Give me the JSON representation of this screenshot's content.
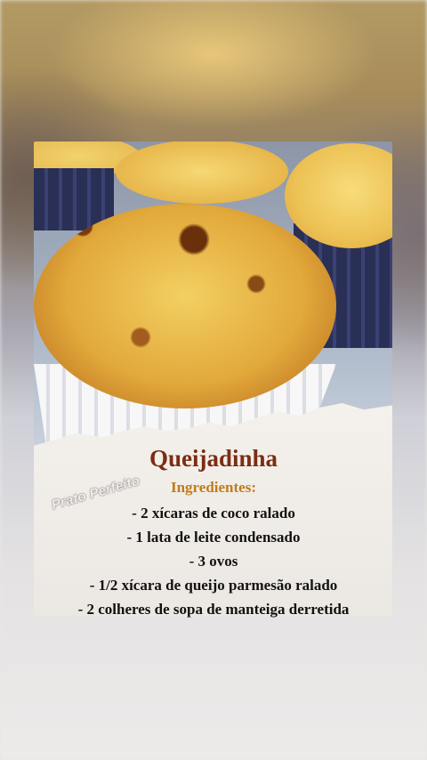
{
  "recipe": {
    "title": "Queijadinha",
    "ingredients_heading": "Ingredientes:",
    "ingredients": [
      "- 2 xícaras de coco ralado",
      "- 1 lata de leite condensado",
      "- 3 ovos",
      "- 1/2 xícara de queijo parmesão ralado",
      "- 2 colheres de sopa de manteiga derretida"
    ]
  },
  "watermark": "Prato Perfeito",
  "colors": {
    "title": "#7b2d13",
    "heading": "#c17c1b",
    "text": "#111111",
    "paper": "#f1eee9"
  }
}
